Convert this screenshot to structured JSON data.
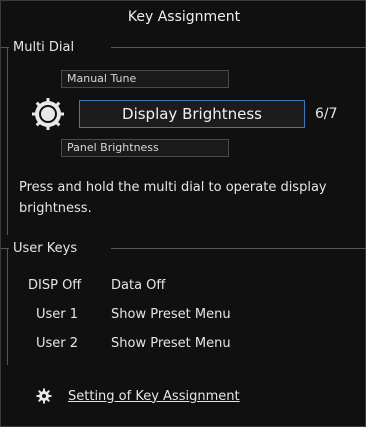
{
  "title": "Key Assignment",
  "multi_dial": {
    "heading": "Multi Dial",
    "prev_item": "Manual Tune",
    "current_item": "Display Brightness",
    "next_item": "Panel Brightness",
    "position": "6/7",
    "description": "Press and hold the multi dial to operate display brightness."
  },
  "user_keys": {
    "heading": "User Keys",
    "rows": [
      {
        "key": "DISP Off",
        "action": "Data Off"
      },
      {
        "key": "User 1",
        "action": "Show Preset Menu"
      },
      {
        "key": "User 2",
        "action": "Show Preset Menu"
      }
    ]
  },
  "setting_link": {
    "label": "Setting of Key Assignment",
    "icon": "gear-icon"
  },
  "colors": {
    "background": "#101010",
    "accent_border": "#3a78b8",
    "text": "#e6e6e6"
  }
}
